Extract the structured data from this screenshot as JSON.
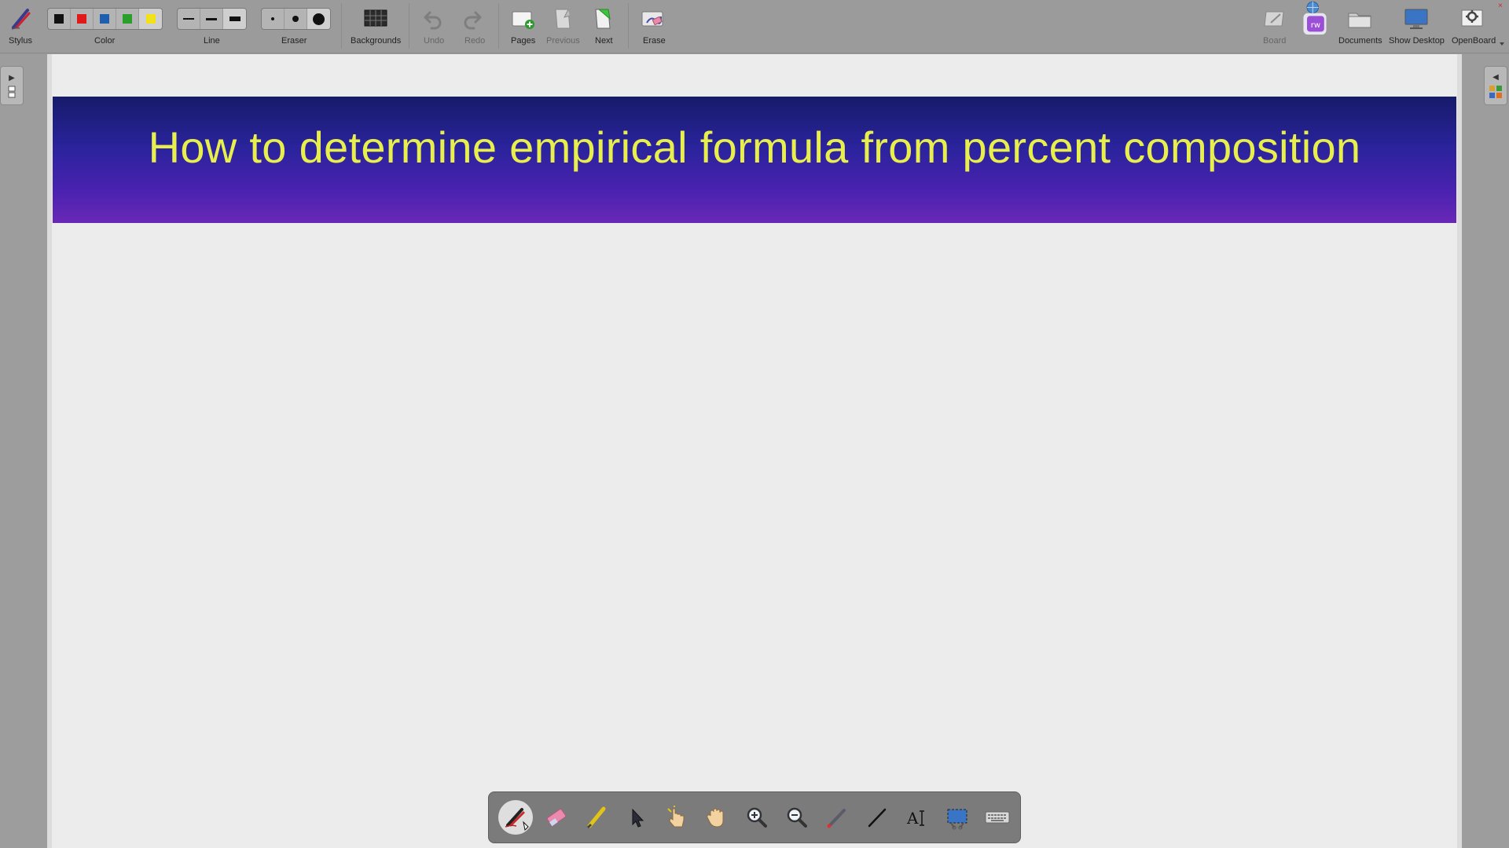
{
  "toolbar": {
    "stylus_label": "Stylus",
    "color_label": "Color",
    "line_label": "Line",
    "eraser_label": "Eraser",
    "backgrounds_label": "Backgrounds",
    "undo_label": "Undo",
    "redo_label": "Redo",
    "pages_label": "Pages",
    "previous_label": "Previous",
    "next_label": "Next",
    "erase_label": "Erase",
    "board_label": "Board",
    "documents_label": "Documents",
    "show_desktop_label": "Show Desktop",
    "openboard_label": "OpenBoard",
    "colors": [
      "#111111",
      "#e01a1a",
      "#1f5fb0",
      "#2aa02a",
      "#f2e21a"
    ],
    "selected_color_index": 4
  },
  "board": {
    "title": "How to determine empirical formula from percent composition",
    "title_color": "#e8ef4c"
  },
  "palette": {
    "tools": [
      "pen-tool",
      "eraser-tool",
      "marker-tool",
      "selector-tool",
      "interact-tool",
      "hand-tool",
      "zoom-in-tool",
      "zoom-out-tool",
      "laser-pointer-tool",
      "line-tool",
      "text-tool",
      "capture-tool",
      "keyboard-tool"
    ],
    "active_tool": "pen-tool"
  }
}
